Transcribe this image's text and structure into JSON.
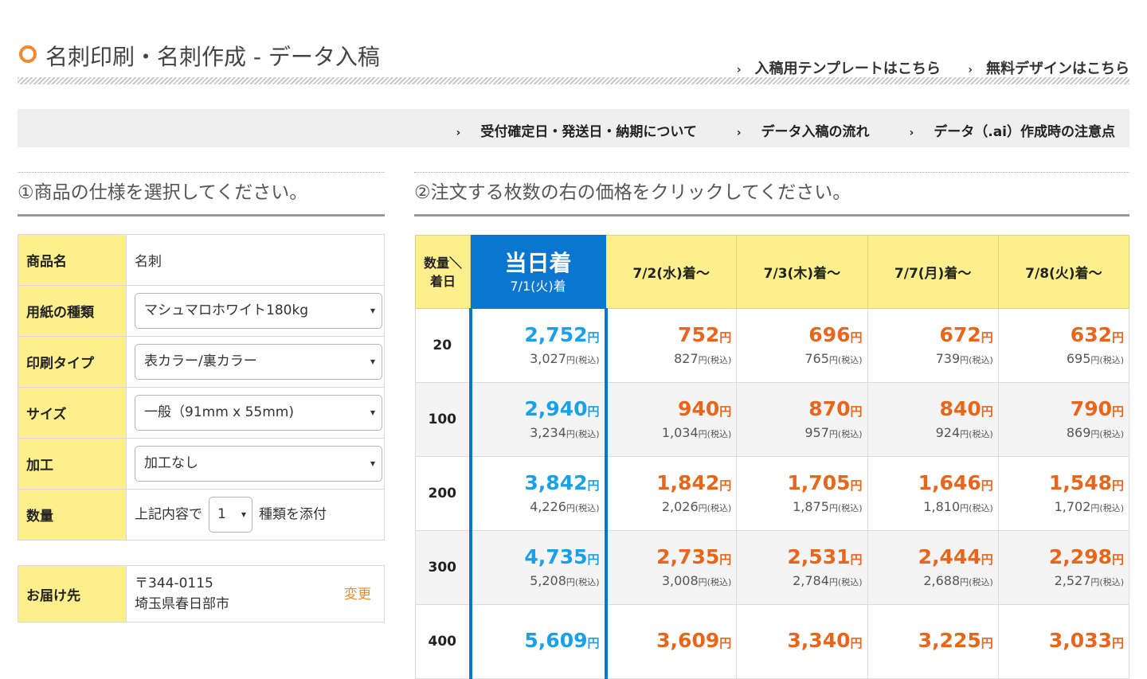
{
  "page": {
    "title": "名刺印刷・名刺作成 - データ入稿",
    "title_links": [
      "入稿用テンプレートはこちら",
      "無料デザインはこちら"
    ],
    "info_links": [
      "受付確定日・発送日・納期について",
      "データ入稿の流れ",
      "データ（.ai）作成時の注意点"
    ]
  },
  "section1": {
    "heading": "①商品の仕様を選択してください。"
  },
  "section2": {
    "heading": "②注文する枚数の右の価格をクリックしてください。"
  },
  "spec": {
    "product_label": "商品名",
    "product_value": "名刺",
    "paper_label": "用紙の種類",
    "paper_value": "マシュマロホワイト180kg",
    "print_label": "印刷タイプ",
    "print_value": "表カラー/裏カラー",
    "size_label": "サイズ",
    "size_value": "一般（91mm x 55mm)",
    "process_label": "加工",
    "process_value": "加工なし",
    "qty_label": "数量",
    "qty_prefix": "上記内容で",
    "qty_value": "1",
    "qty_suffix": "種類を添付"
  },
  "delivery": {
    "label": "お届け先",
    "postal": "〒344-0115",
    "address": "埼玉県春日部市",
    "change": "変更"
  },
  "price_table": {
    "qty_header_line1": "数量＼",
    "qty_header_line2": "着日",
    "today_main": "当日着",
    "today_sub": "7/1(火)着",
    "headers": [
      "7/2(水)着〜",
      "7/3(木)着〜",
      "7/7(月)着〜",
      "7/8(火)着〜"
    ],
    "yen": "円",
    "tax_label": "円(税込)",
    "rows": [
      {
        "qty": "20",
        "prices": [
          {
            "p": "2,752",
            "t": "3,027"
          },
          {
            "p": "752",
            "t": "827"
          },
          {
            "p": "696",
            "t": "765"
          },
          {
            "p": "672",
            "t": "739"
          },
          {
            "p": "632",
            "t": "695"
          }
        ]
      },
      {
        "qty": "100",
        "prices": [
          {
            "p": "2,940",
            "t": "3,234"
          },
          {
            "p": "940",
            "t": "1,034"
          },
          {
            "p": "870",
            "t": "957"
          },
          {
            "p": "840",
            "t": "924"
          },
          {
            "p": "790",
            "t": "869"
          }
        ]
      },
      {
        "qty": "200",
        "prices": [
          {
            "p": "3,842",
            "t": "4,226"
          },
          {
            "p": "1,842",
            "t": "2,026"
          },
          {
            "p": "1,705",
            "t": "1,875"
          },
          {
            "p": "1,646",
            "t": "1,810"
          },
          {
            "p": "1,548",
            "t": "1,702"
          }
        ]
      },
      {
        "qty": "300",
        "prices": [
          {
            "p": "4,735",
            "t": "5,208"
          },
          {
            "p": "2,735",
            "t": "3,008"
          },
          {
            "p": "2,531",
            "t": "2,784"
          },
          {
            "p": "2,444",
            "t": "2,688"
          },
          {
            "p": "2,298",
            "t": "2,527"
          }
        ]
      },
      {
        "qty": "400",
        "prices": [
          {
            "p": "5,609",
            "t": ""
          },
          {
            "p": "3,609",
            "t": ""
          },
          {
            "p": "3,340",
            "t": ""
          },
          {
            "p": "3,225",
            "t": ""
          },
          {
            "p": "3,033",
            "t": ""
          }
        ]
      }
    ]
  },
  "colors": {
    "accent_orange": "#f08a2c",
    "today_blue": "#0a76d2",
    "header_yellow": "#fdf08c",
    "price_orange": "#e8661c",
    "price_blue": "#1aa0e8"
  }
}
